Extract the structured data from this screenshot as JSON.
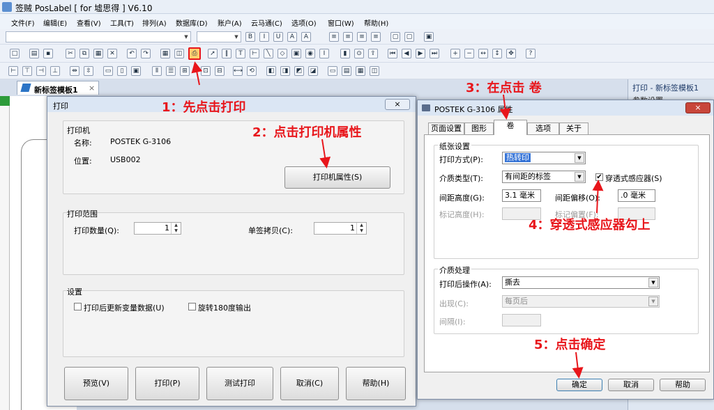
{
  "app": {
    "title": "签贼 PosLabel [ for 墟思得 ]  V6.10"
  },
  "menu": [
    "文件(F)",
    "编辑(E)",
    "查看(V)",
    "工具(T)",
    "排列(A)",
    "数据库(D)",
    "账户(A)",
    "云马通(C)",
    "选项(O)",
    "窗口(W)",
    "帮助(H)"
  ],
  "doc_tab": {
    "label": "新标签模板1",
    "close": "×"
  },
  "right_panel": {
    "header": "打印 - 新标签模板1",
    "sub": "参数设置"
  },
  "print_dialog": {
    "title": "打印",
    "close": "×",
    "printer_group": "打印机",
    "name_label": "名称:",
    "name_value": "POSTEK G-3106",
    "location_label": "位置:",
    "location_value": "USB002",
    "props_button": "打印机属性(S)",
    "range_group": "打印范围",
    "qty_label": "打印数量(Q):",
    "qty_value": "1",
    "copies_label": "单签拷贝(C):",
    "copies_value": "1",
    "settings_group": "设置",
    "cb_update": "打印后更新变量数据(U)",
    "cb_rotate": "旋转180度输出",
    "buttons": [
      "预览(V)",
      "打印(P)",
      "测试打印",
      "取消(C)",
      "帮助(H)"
    ]
  },
  "props_dialog": {
    "title": "POSTEK G-3106 属性",
    "close": "×",
    "tabs": [
      "页面设置",
      "图形",
      "卷",
      "选项",
      "关于"
    ],
    "paper_group": "纸张设置",
    "print_method_label": "打印方式(P):",
    "print_method_value": "热转印",
    "media_type_label": "介质类型(T):",
    "media_type_value": "有间距的标签",
    "sensor_checkbox": "穿透式感应器(S)",
    "sensor_checked": true,
    "gap_height_label": "间距高度(G):",
    "gap_height_value": "3.1 毫米",
    "gap_offset_label": "间距偏移(O):",
    "gap_offset_value": ".0 毫米",
    "mark_height_label": "标记高度(H):",
    "mark_offset_label": "标记偏置(F):",
    "media_group": "介质处理",
    "post_action_label": "打印后操作(A):",
    "post_action_value": "撕去",
    "occurrence_label": "出现(C):",
    "occurrence_value": "每页后",
    "interval_label": "间隔(I):",
    "buttons": [
      "确定",
      "取消",
      "帮助"
    ]
  },
  "annotations": {
    "step1": "1：先点击打印",
    "step2": "2：点击打印机属性",
    "step3": "3：在点击  卷",
    "step4": "4：穿透式感应器勾上",
    "step5": "5：点击确定",
    "color": "#e8161b"
  }
}
